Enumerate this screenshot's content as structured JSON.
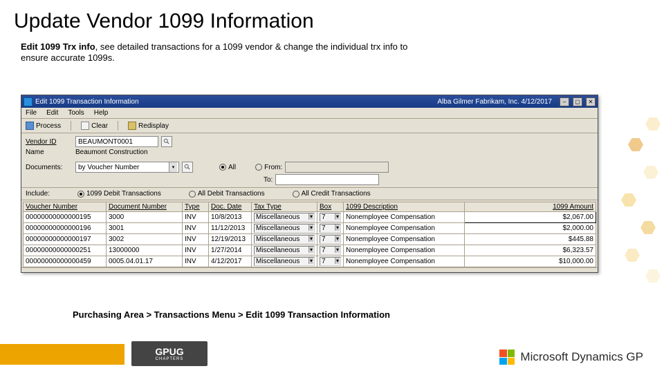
{
  "slide": {
    "title": "Update Vendor 1099 Information",
    "subtitle_bold": "Edit 1099 Trx info",
    "subtitle_rest": ", see detailed transactions for a 1099 vendor & change the individual trx info to ensure accurate 1099s.",
    "nav_path": "Purchasing Area > Transactions Menu > Edit 1099 Transaction Information",
    "footer_brand": "GPUG",
    "footer_sub": "CHAPTERS",
    "ms_brand": "Microsoft Dynamics GP"
  },
  "window": {
    "title": "Edit 1099 Transaction Information",
    "user_context": "Alba Gilmer   Fabrikam, Inc.   4/12/2017",
    "menu": {
      "file": "File",
      "edit": "Edit",
      "tools": "Tools",
      "help": "Help"
    },
    "toolbar": {
      "process": "Process",
      "clear": "Clear",
      "redisplay": "Redisplay"
    },
    "labels": {
      "vendor_id": "Vendor ID",
      "name": "Name",
      "documents": "Documents:",
      "include": "Include:",
      "all": "All",
      "from": "From:",
      "to": "To:",
      "opt1": "1099 Debit Transactions",
      "opt2": "All Debit Transactions",
      "opt3": "All Credit Transactions",
      "doc_dropdown": "by Voucher Number"
    },
    "fields": {
      "vendor_id": "BEAUMONT0001",
      "name": "Beaumont Construction",
      "to": ""
    },
    "columns": {
      "voucher": "Voucher Number",
      "doc": "Document Number",
      "type": "Type",
      "date": "Doc. Date",
      "tax": "Tax Type",
      "box": "Box",
      "desc": "1099 Description",
      "amount": "1099 Amount"
    },
    "rows": [
      {
        "voucher": "00000000000000195",
        "doc": "3000",
        "type": "INV",
        "date": "10/8/2013",
        "tax": "Miscellaneous",
        "box": "7",
        "desc": "Nonemployee Compensation",
        "amount": "$2,067.00"
      },
      {
        "voucher": "00000000000000196",
        "doc": "3001",
        "type": "INV",
        "date": "11/12/2013",
        "tax": "Miscellaneous",
        "box": "7",
        "desc": "Nonemployee Compensation",
        "amount": "$2,000.00"
      },
      {
        "voucher": "00000000000000197",
        "doc": "3002",
        "type": "INV",
        "date": "12/19/2013",
        "tax": "Miscellaneous",
        "box": "7",
        "desc": "Nonemployee Compensation",
        "amount": "$445.88"
      },
      {
        "voucher": "00000000000000251",
        "doc": "13000000",
        "type": "INV",
        "date": "1/27/2014",
        "tax": "Miscellaneous",
        "box": "7",
        "desc": "Nonemployee Compensation",
        "amount": "$6,323.57"
      },
      {
        "voucher": "00000000000000459",
        "doc": "0005.04.01.17",
        "type": "INV",
        "date": "4/12/2017",
        "tax": "Miscellaneous",
        "box": "7",
        "desc": "Nonemployee Compensation",
        "amount": "$10,000.00"
      }
    ]
  }
}
